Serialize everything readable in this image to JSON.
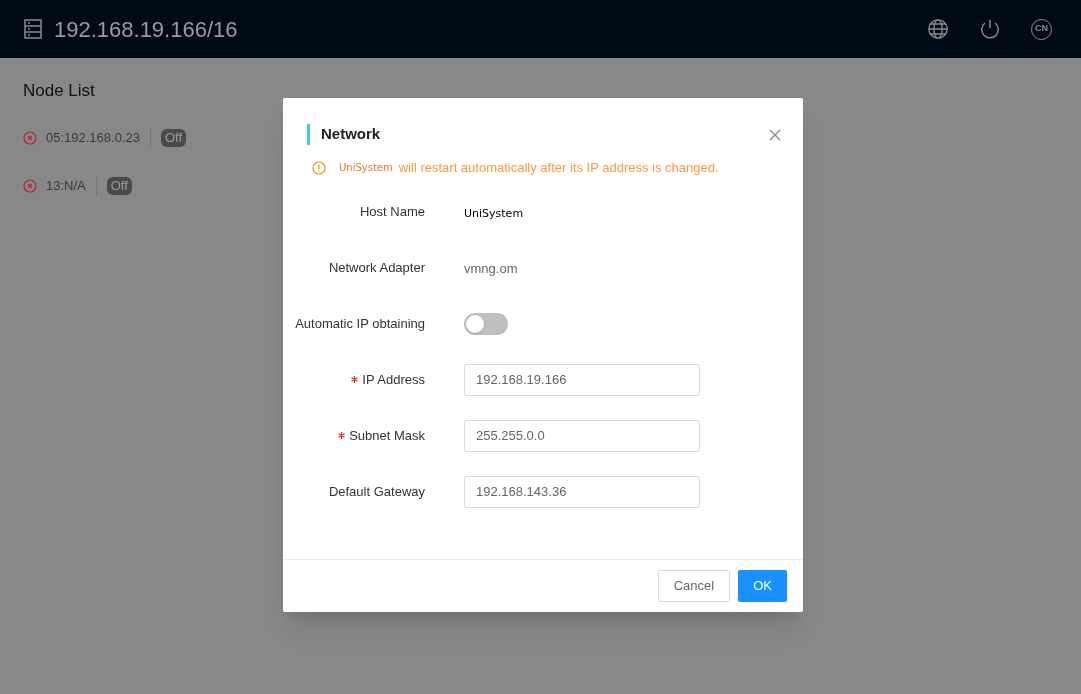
{
  "header": {
    "title": "192.168.19.166/16",
    "language": "CN"
  },
  "node_list": {
    "title": "Node List",
    "nodes": [
      {
        "name": "05:192.168.0.23",
        "connected": false,
        "badge": "Off"
      },
      {
        "name": "13:N/A",
        "connected": false,
        "badge": "Off"
      }
    ]
  },
  "dialog": {
    "title": "Network",
    "warning": {
      "app_name": "UniSystem",
      "message": "will restart automatically after its IP address is changed."
    },
    "fields": [
      {
        "kind": "text",
        "label": "Host Name",
        "value": "UniSystem",
        "emphasis": true
      },
      {
        "kind": "text",
        "label": "Network Adapter",
        "value": "vmng.om",
        "emphasis": false
      },
      {
        "kind": "toggle",
        "label": "Automatic IP obtaining",
        "on": false
      },
      {
        "kind": "input",
        "label": "IP Address",
        "required": true,
        "value": "192.168.19.166"
      },
      {
        "kind": "input",
        "label": "Subnet Mask",
        "required": true,
        "value": "255.255.0.0"
      },
      {
        "kind": "input",
        "label": "Default Gateway",
        "required": false,
        "value": "192.168.143.36"
      }
    ],
    "buttons": [
      {
        "label": "Cancel",
        "primary": false
      },
      {
        "label": "OK",
        "primary": true
      }
    ]
  }
}
